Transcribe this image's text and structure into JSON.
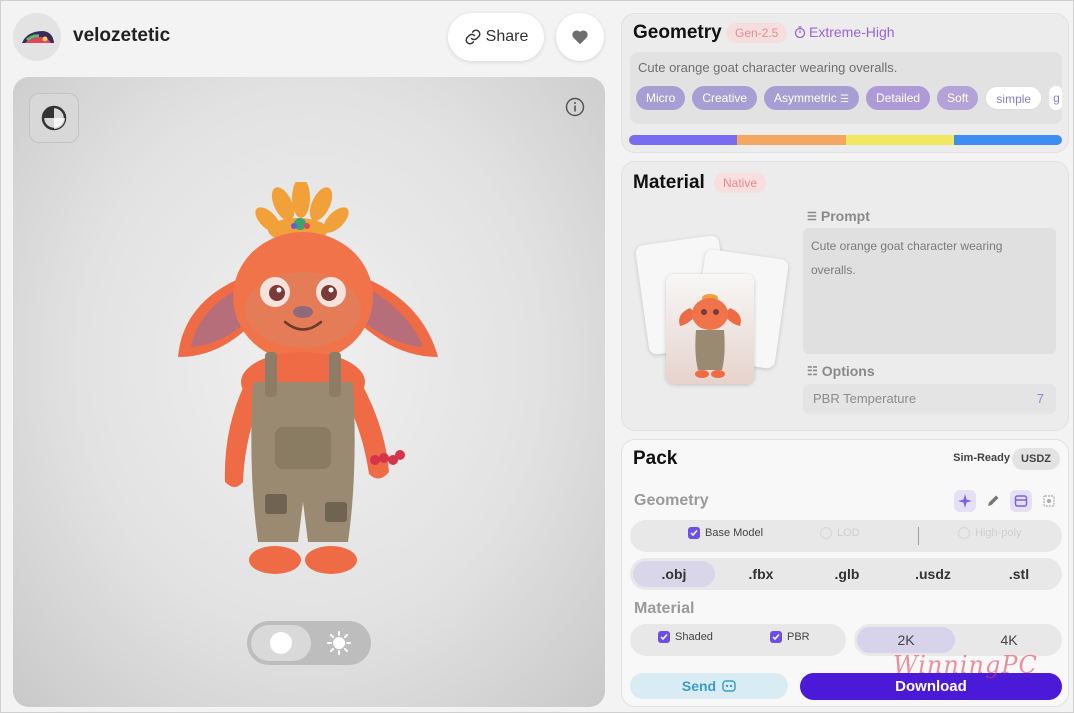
{
  "user": {
    "name": "velozetetic"
  },
  "header": {
    "share_label": "Share"
  },
  "geometry": {
    "title": "Geometry",
    "version_badge": "Gen-2.5",
    "quality": "Extreme-High",
    "prompt": "Cute orange goat character wearing overalls.",
    "chips": [
      "Micro",
      "Creative",
      "Asymmetric",
      "Detailed",
      "Soft",
      "simple",
      "g"
    ],
    "spectrum_colors": [
      "#7a6cf0",
      "#f2a860",
      "#efe860",
      "#3d8ef0"
    ]
  },
  "material": {
    "title": "Material",
    "badge": "Native",
    "prompt_label": "Prompt",
    "prompt": "Cute orange goat character wearing overalls.",
    "options_label": "Options",
    "option_name": "PBR Temperature",
    "option_value": "7"
  },
  "pack": {
    "title": "Pack",
    "simready": "Sim-Ready",
    "format_badge": "USDZ",
    "geometry_label": "Geometry",
    "geometry_options": [
      {
        "label": "Base Model",
        "checked": true
      },
      {
        "label": "LOD",
        "checked": false
      },
      {
        "label": "High-poly",
        "checked": false
      }
    ],
    "formats": [
      ".obj",
      ".fbx",
      ".glb",
      ".usdz",
      ".stl"
    ],
    "selected_format": ".obj",
    "material_label": "Material",
    "material_options": [
      {
        "label": "Shaded",
        "checked": true
      },
      {
        "label": "PBR",
        "checked": true
      }
    ],
    "resolutions": [
      "2K",
      "4K"
    ],
    "selected_resolution": "2K",
    "send_label": "Send",
    "download_label": "Download"
  },
  "watermark": "WinningPC",
  "colors": {
    "accent": "#4b19d8",
    "lilac": "#a79fd4",
    "send": "#3a9cc9"
  }
}
